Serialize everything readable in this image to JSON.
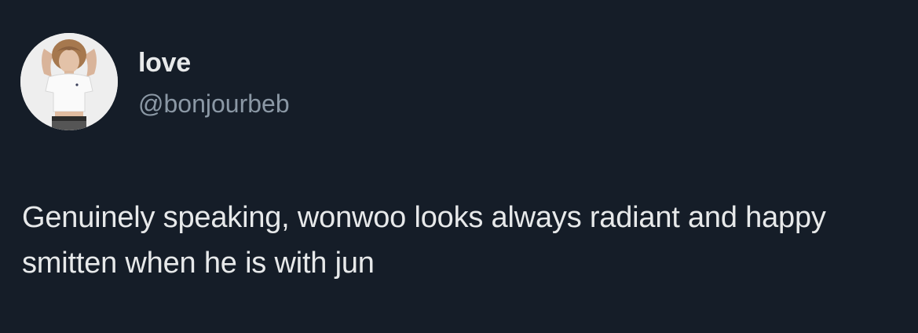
{
  "tweet": {
    "author": {
      "display_name": "love",
      "handle": "@bonjourbeb",
      "avatar_icon": "user-avatar"
    },
    "text": "Genuinely speaking, wonwoo looks always radiant and happy smitten when he is with jun"
  },
  "colors": {
    "background": "#151d28",
    "primary_text": "#e7e9ea",
    "secondary_text": "#8b98a5"
  }
}
